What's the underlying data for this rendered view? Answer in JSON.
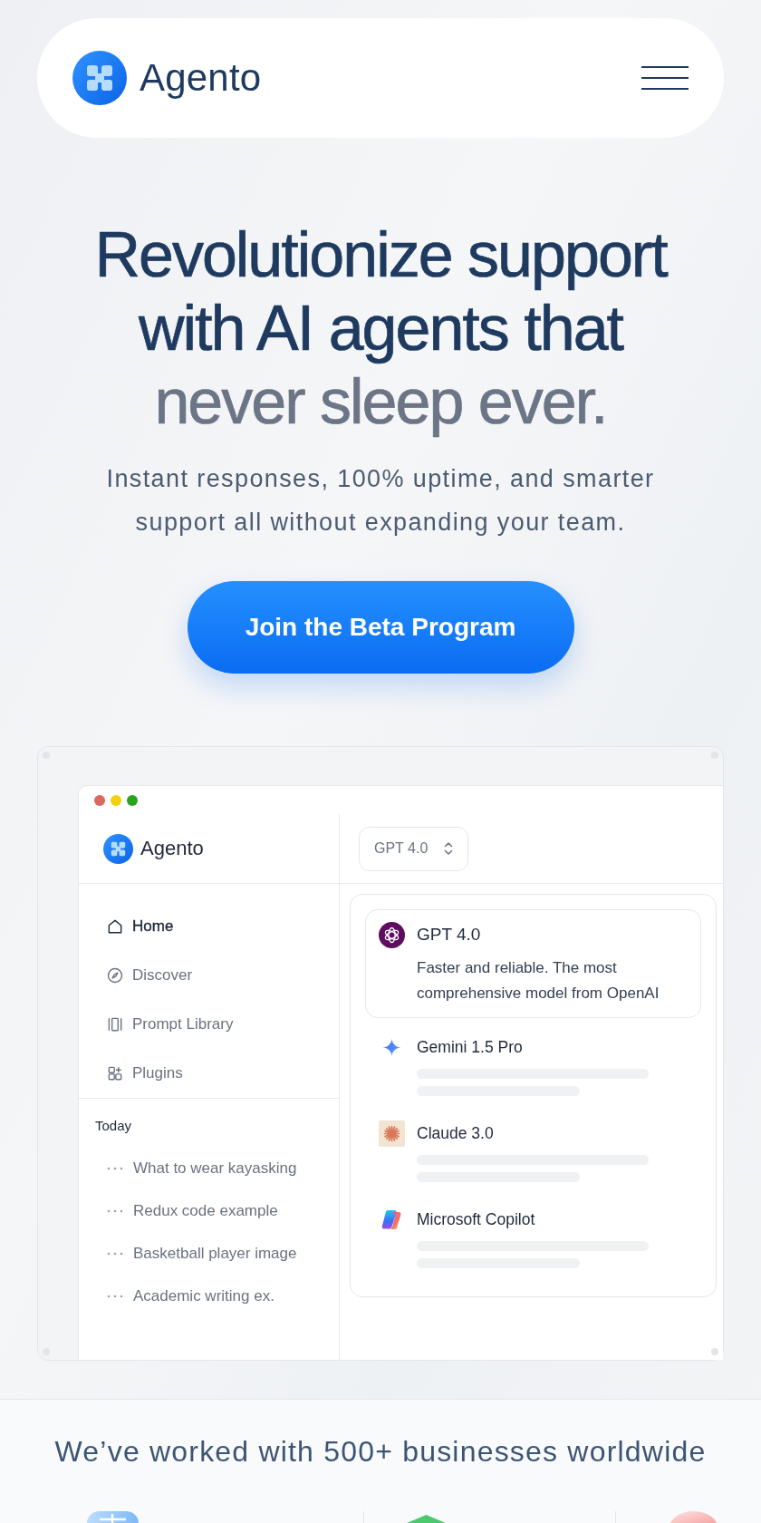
{
  "header": {
    "brand": "Agento"
  },
  "hero": {
    "headline": "Revolutionize support with AI agents that",
    "headline_muted": "never sleep ever.",
    "subtitle": "Instant responses, 100% uptime, and smarter support all without expanding your team.",
    "cta": "Join the Beta Program"
  },
  "app_preview": {
    "brand": "Agento",
    "model_picker": {
      "value": "GPT 4.0"
    },
    "nav": [
      {
        "label": "Home",
        "selected": true
      },
      {
        "label": "Discover",
        "selected": false
      },
      {
        "label": "Prompt Library",
        "selected": false
      },
      {
        "label": "Plugins",
        "selected": false
      }
    ],
    "history_heading": "Today",
    "history": [
      "What to wear kayasking",
      "Redux code example",
      "Basketball player image",
      "Academic writing ex."
    ],
    "models": [
      {
        "name": "GPT 4.0",
        "selected": true,
        "description": "Faster and reliable. The most comprehensive model from OpenAI"
      },
      {
        "name": "Gemini 1.5 Pro",
        "selected": false
      },
      {
        "name": "Claude 3.0",
        "selected": false
      },
      {
        "name": "Microsoft Copilot",
        "selected": false
      }
    ]
  },
  "clients": {
    "heading": "We’ve worked with 500+ businesses worldwide"
  }
}
